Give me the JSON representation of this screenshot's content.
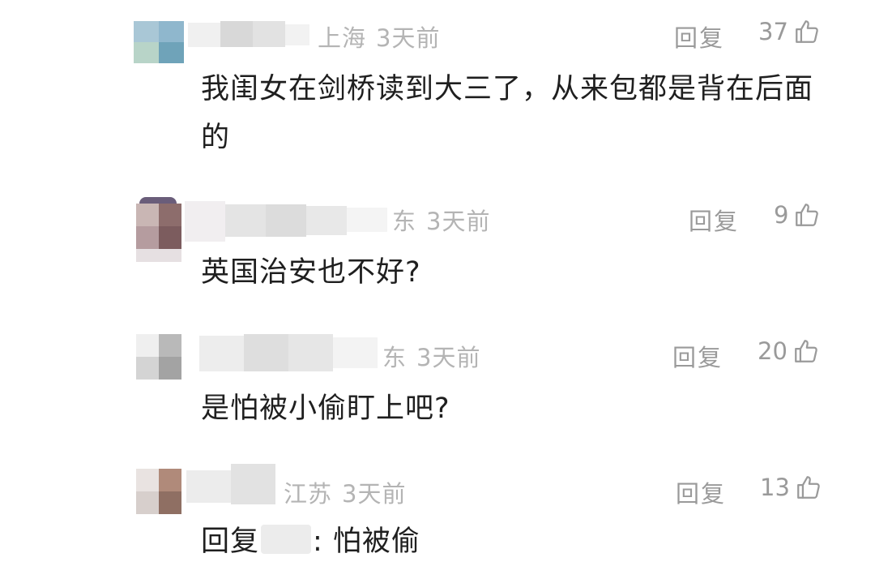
{
  "comments": [
    {
      "location": "上海",
      "time": "3天前",
      "reply_label": "回复",
      "likes": "37",
      "text": "我闺女在剑桥读到大三了，从来包都是背在后面的"
    },
    {
      "location": "东",
      "time": "3天前",
      "reply_label": "回复",
      "likes": "9",
      "text": "英国治安也不好?"
    },
    {
      "location": "东",
      "time": "3天前",
      "reply_label": "回复",
      "likes": "20",
      "text": "是怕被小偷盯上吧?"
    },
    {
      "location": "江苏",
      "time": "3天前",
      "reply_label": "回复",
      "likes": "13",
      "text_prefix": "回复",
      "text_suffix": ": 怕被偷"
    }
  ],
  "icons": {
    "like": "thumbs-up-icon"
  },
  "colors": {
    "meta": "#b4b4b4",
    "action": "#9a9a9a",
    "text": "#1f1f1f"
  }
}
